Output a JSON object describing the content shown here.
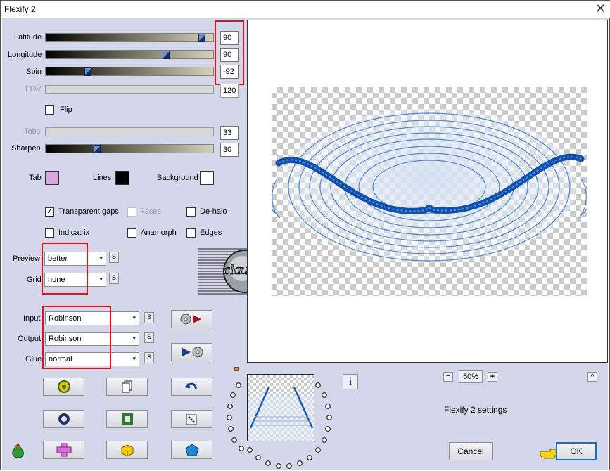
{
  "window": {
    "title": "Flexify 2",
    "close_symbol": "✕"
  },
  "params": {
    "latitude": {
      "label": "Latitude",
      "value": "90",
      "level": 0.95
    },
    "longitude": {
      "label": "Longitude",
      "value": "90",
      "level": 0.73
    },
    "spin": {
      "label": "Spin",
      "value": "-92",
      "level": 0.24
    },
    "fov": {
      "label": "FOV",
      "value": "120"
    },
    "tabs": {
      "label": "Tabs",
      "value": "33"
    },
    "sharpen": {
      "label": "Sharpen",
      "value": "30",
      "level": 0.3
    }
  },
  "flip": {
    "label": "Flip",
    "checked": false
  },
  "colors": {
    "tab": {
      "label": "Tab",
      "color": "#d9a7dc"
    },
    "lines": {
      "label": "Lines",
      "color": "#000000"
    },
    "background": {
      "label": "Background",
      "color": "#ffffff"
    },
    "highlight": "#e1141c",
    "accent": "#1a57b8"
  },
  "options": {
    "transparent_gaps": {
      "label": "Transparent gaps",
      "checked": true,
      "mark": "✓"
    },
    "faces": {
      "label": "Faces",
      "checked": false
    },
    "de_halo": {
      "label": "De-halo",
      "checked": false
    },
    "indicatrix": {
      "label": "Indicatrix",
      "checked": false
    },
    "anamorph": {
      "label": "Anamorph",
      "checked": false
    },
    "edges": {
      "label": "Edges",
      "checked": false
    }
  },
  "dropdowns": {
    "preview": {
      "label": "Preview",
      "value": "better"
    },
    "grid": {
      "label": "Grid",
      "value": "none"
    },
    "input": {
      "label": "Input",
      "value": "Robinson"
    },
    "output": {
      "label": "Output",
      "value": "Robinson"
    },
    "glue": {
      "label": "Glue",
      "value": "normal"
    },
    "s_label": "S",
    "arrow": "▾"
  },
  "watermark": {
    "text": "claudia"
  },
  "zoom": {
    "minus": "−",
    "value": "50%",
    "plus": "+",
    "collapse": "^"
  },
  "info_symbol": "i",
  "settings_label": "Flexify 2 settings",
  "footer": {
    "cancel": "Cancel",
    "ok": "OK"
  }
}
